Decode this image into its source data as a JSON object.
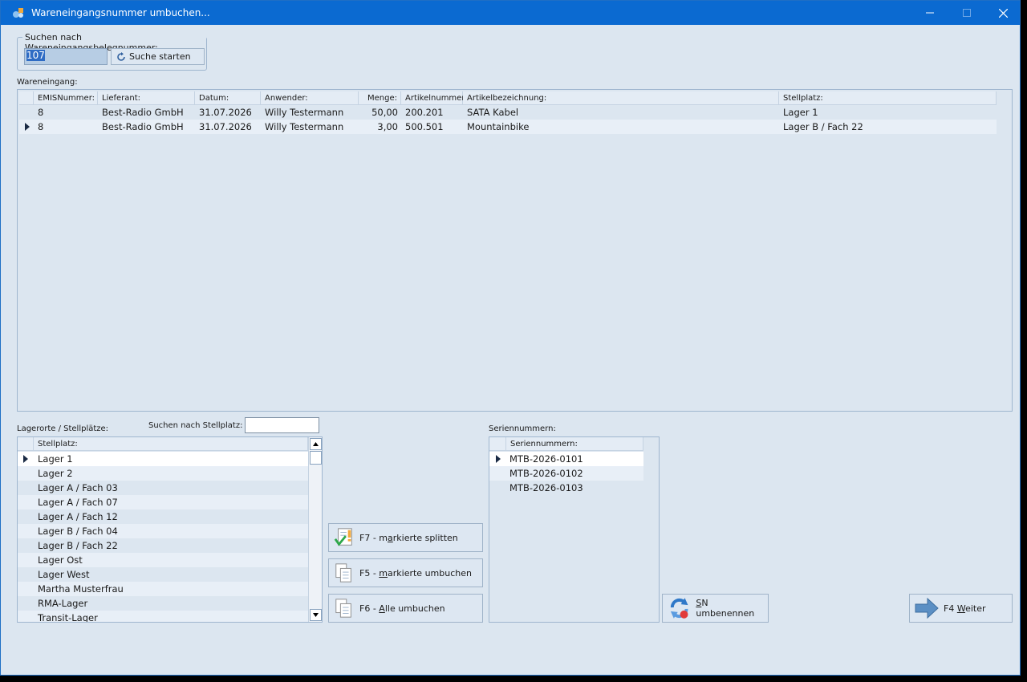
{
  "window": {
    "title": "Wareneingangsnummer umbuchen..."
  },
  "search": {
    "group_label": "Suchen nach Wareneingangsbelegnummer:",
    "value": "107",
    "button_label": "Suche starten"
  },
  "wareneingang": {
    "label": "Wareneingang:",
    "columns": [
      "EMISNummer:",
      "Lieferant:",
      "Datum:",
      "Anwender:",
      "Menge:",
      "Artikelnummer",
      "Artikelbezeichnung:",
      "Stellplatz:"
    ],
    "rows": [
      {
        "emis": "8",
        "lieferant": "Best-Radio GmbH",
        "datum": "31.07.2026",
        "anwender": "Willy Testermann",
        "menge": "50,00",
        "artikelnummer": "200.201",
        "bezeichnung": "SATA Kabel",
        "stellplatz": "Lager 1"
      },
      {
        "emis": "8",
        "lieferant": "Best-Radio GmbH",
        "datum": "31.07.2026",
        "anwender": "Willy Testermann",
        "menge": "3,00",
        "artikelnummer": "500.501",
        "bezeichnung": "Mountainbike",
        "stellplatz": "Lager B / Fach 22"
      }
    ]
  },
  "lagerorte": {
    "label": "Lagerorte / Stellplätze:",
    "search_label": "Suchen nach Stellplatz:",
    "column": "Stellplatz:",
    "items": [
      "Lager 1",
      "Lager 2",
      "Lager A / Fach 03",
      "Lager A / Fach 07",
      "Lager A / Fach 12",
      "Lager B / Fach 04",
      "Lager B / Fach 22",
      "Lager Ost",
      "Lager West",
      "Martha Musterfrau",
      "RMA-Lager",
      "Transit-Lager"
    ]
  },
  "seriennummern": {
    "label": "Seriennummern:",
    "column": "Seriennummern:",
    "items": [
      "MTB-2026-0101",
      "MTB-2026-0102",
      "MTB-2026-0103"
    ]
  },
  "actions": {
    "split": {
      "pre": "F7 - m",
      "u": "a",
      "post": "rkierte splitten"
    },
    "move_marked": {
      "pre": "F5 - ",
      "u": "m",
      "post": "arkierte umbuchen"
    },
    "move_all": {
      "pre": "F6 - ",
      "u": "A",
      "post": "lle umbuchen"
    },
    "rename_sn": {
      "pre": "",
      "u": "S",
      "post": "N umbenennen"
    },
    "next": {
      "pre": "F4 ",
      "u": "W",
      "post": "eiter"
    }
  },
  "colors": {
    "titlebar": "#0b6ad1",
    "window_bg": "#dce6f0",
    "row_alt": "#e8eff7",
    "selection": "#2f6cc4"
  }
}
